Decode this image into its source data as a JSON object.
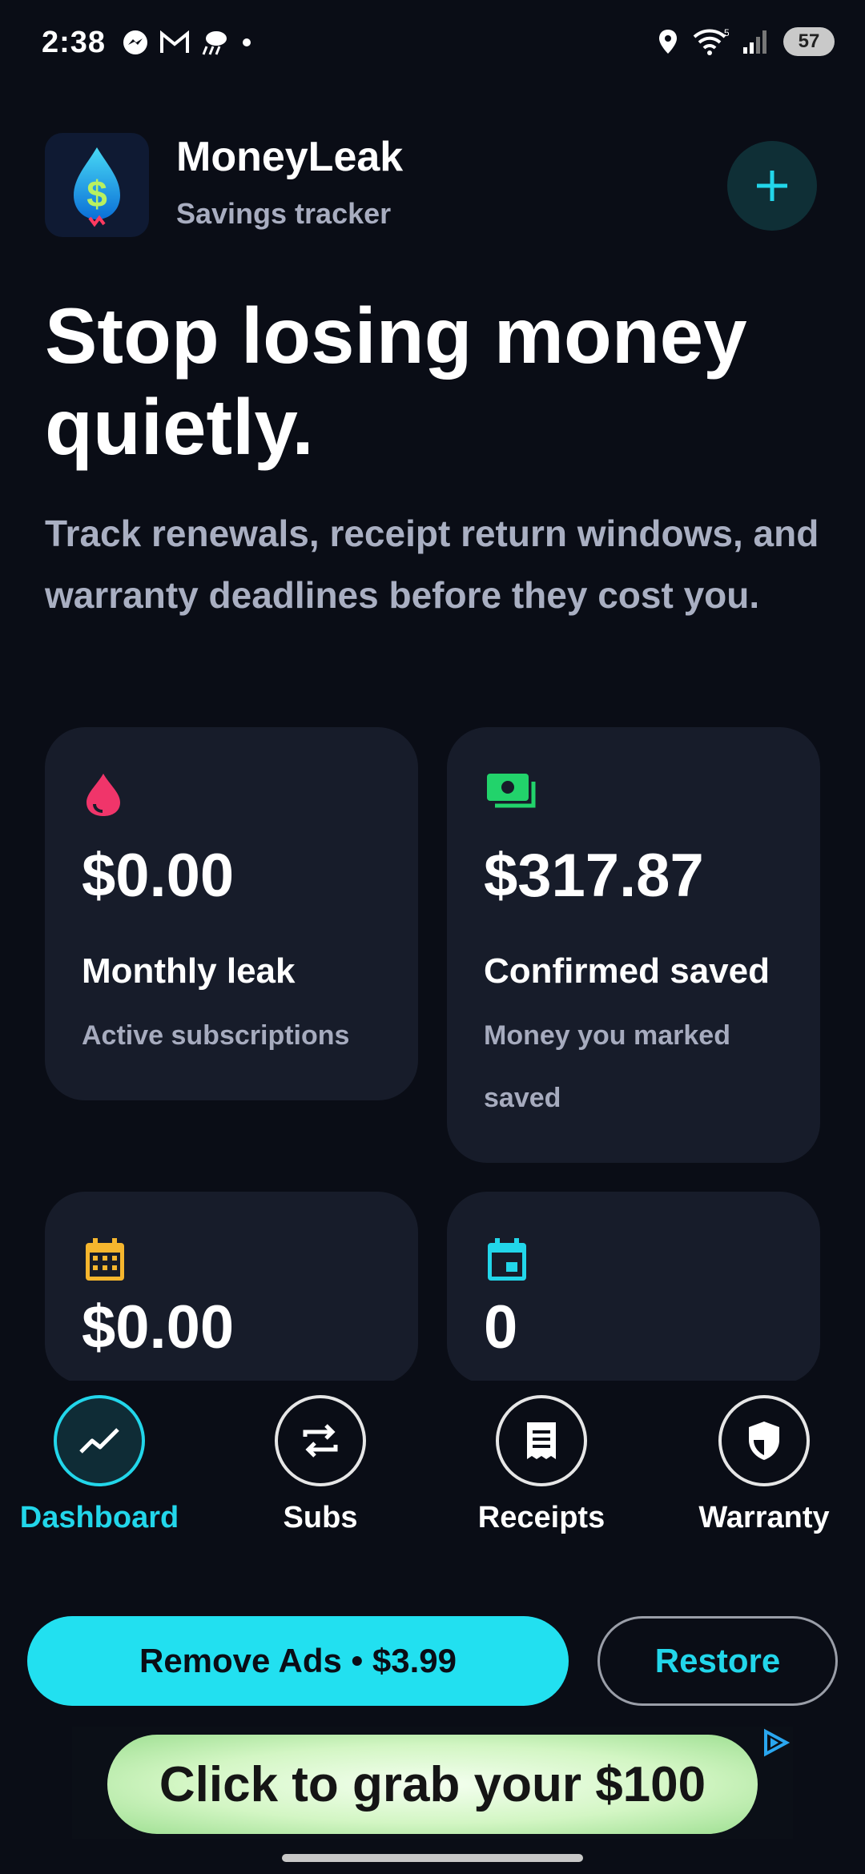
{
  "status_bar": {
    "time": "2:38",
    "battery": "57",
    "left_icons": [
      "messenger-icon",
      "gmail-icon",
      "weather-icon",
      "dot-icon"
    ],
    "right_icons": [
      "location-icon",
      "wifi-icon",
      "signal-icon"
    ]
  },
  "header": {
    "app_title": "MoneyLeak",
    "app_subtitle": "Savings tracker",
    "logo_icon": "money-drop-logo",
    "add_icon": "plus-icon"
  },
  "hero": {
    "title": "Stop losing money quietly.",
    "subtitle": "Track renewals, receipt return windows, and warranty deadlines before they cost you."
  },
  "cards": [
    {
      "icon": "drop-icon",
      "icon_color": "#f0356a",
      "amount": "$0.00",
      "title": "Monthly leak",
      "desc": "Active subscriptions"
    },
    {
      "icon": "money-icon",
      "icon_color": "#22d36b",
      "amount": "$317.87",
      "title": "Confirmed saved",
      "desc": "Money you marked saved"
    },
    {
      "icon": "calendar-grid-icon",
      "icon_color": "#f6b62e",
      "amount": "$0.00"
    },
    {
      "icon": "calendar-event-icon",
      "icon_color": "#22d6ea",
      "amount": "0"
    }
  ],
  "nav": {
    "items": [
      {
        "label": "Dashboard",
        "icon": "trend-icon",
        "active": true
      },
      {
        "label": "Subs",
        "icon": "repeat-icon",
        "active": false
      },
      {
        "label": "Receipts",
        "icon": "receipt-icon",
        "active": false
      },
      {
        "label": "Warranty",
        "icon": "shield-icon",
        "active": false
      }
    ]
  },
  "purchase": {
    "remove_ads_label": "Remove Ads • $3.99",
    "restore_label": "Restore"
  },
  "ad": {
    "text": "Click to grab your $100"
  },
  "colors": {
    "background": "#0a0d16",
    "card": "#171c2a",
    "accent": "#22d6ea",
    "muted_text": "#a8adc0"
  }
}
